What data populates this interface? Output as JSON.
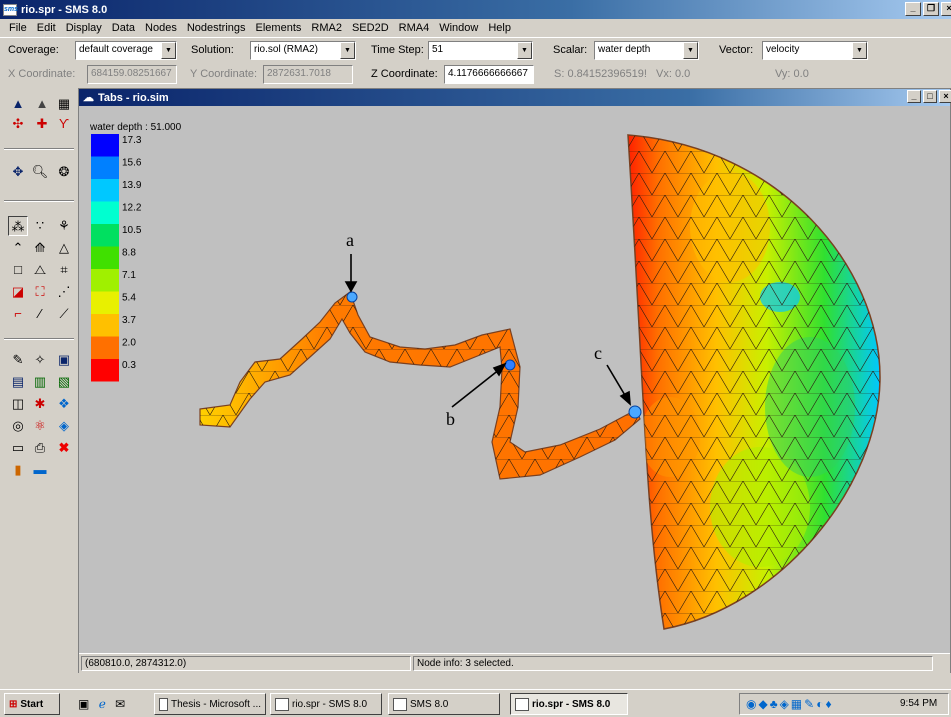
{
  "app": {
    "title": "rio.spr - SMS 8.0"
  },
  "menu": [
    "File",
    "Edit",
    "Display",
    "Data",
    "Nodes",
    "Nodestrings",
    "Elements",
    "RMA2",
    "SED2D",
    "RMA4",
    "Window",
    "Help"
  ],
  "toolbar": {
    "coverage_label": "Coverage:",
    "coverage_value": "default coverage",
    "solution_label": "Solution:",
    "solution_value": "rio.sol (RMA2)",
    "timestep_label": "Time Step:",
    "timestep_value": "51",
    "scalar_label": "Scalar:",
    "scalar_value": "water depth",
    "vector_label": "Vector:",
    "vector_value": "velocity",
    "x_label": "X Coordinate:",
    "x_value": "684159.08251667",
    "y_label": "Y Coordinate:",
    "y_value": "2872631.7018",
    "z_label": "Z Coordinate:",
    "z_value": "4.1176666666667",
    "s_text": "S:  0.84152396519!",
    "vx_text": "Vx: 0.0",
    "vy_text": "Vy: 0.0"
  },
  "child": {
    "title": "Tabs - rio.sim"
  },
  "legend": {
    "title": "water depth : 51.000",
    "values": [
      "17.3",
      "15.6",
      "13.9",
      "12.2",
      "10.5",
      "8.8",
      "7.1",
      "5.4",
      "3.7",
      "2.0",
      "0.3"
    ],
    "colors": [
      "#0000ff",
      "#0080ff",
      "#00c8ff",
      "#00ffd0",
      "#00e060",
      "#40e000",
      "#a0f000",
      "#e8f000",
      "#ffc000",
      "#ff7000",
      "#ff0000"
    ]
  },
  "annotations": {
    "a": "a",
    "b": "b",
    "c": "c"
  },
  "status": {
    "coords": "(680810.0, 2874312.0)",
    "node_info": "Node info: 3 selected."
  },
  "taskbar": {
    "start": "Start",
    "tasks": [
      "Thesis - Microsoft ...",
      "rio.spr - SMS 8.0",
      "SMS 8.0",
      "rio.spr - SMS 8.0"
    ],
    "clock": "9:54 PM"
  }
}
